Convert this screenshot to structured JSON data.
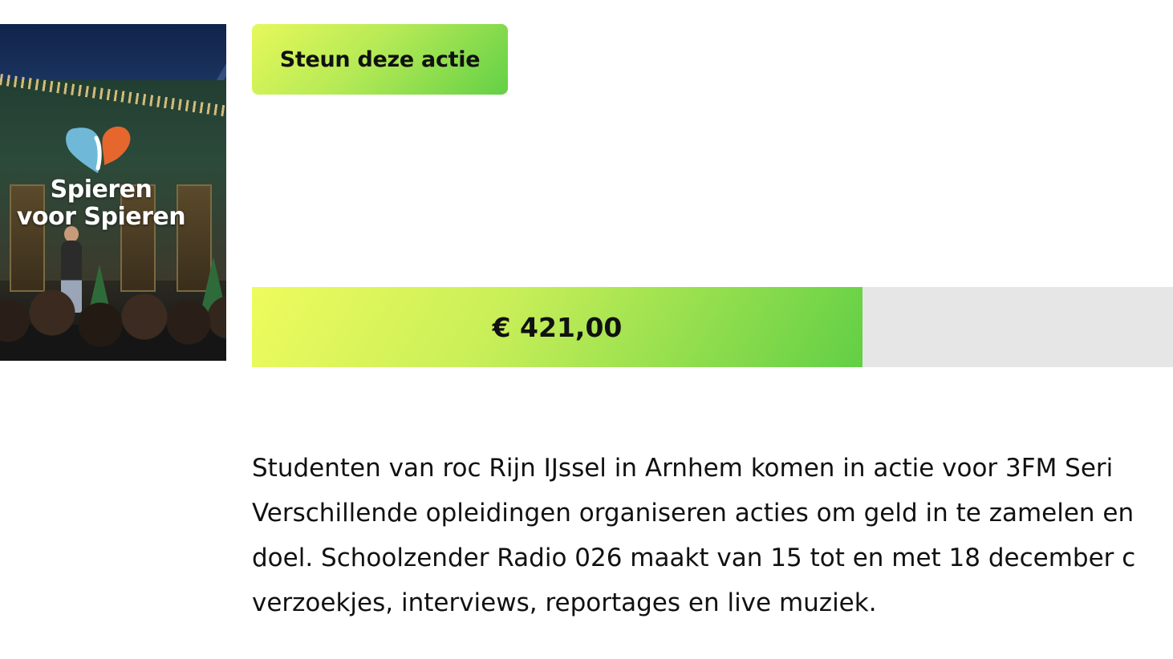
{
  "campaign": {
    "image_logo_text_line1": "Spieren",
    "image_logo_text_line2": "voor Spieren",
    "heart_colors": {
      "left": "#6fb8d8",
      "right": "#e5672d"
    }
  },
  "cta": {
    "label": "Steun deze actie",
    "gradient_start": "#e6f85a",
    "gradient_end": "#63d046"
  },
  "progress": {
    "amount_label": "€ 421,00",
    "fill_fraction": 0.656,
    "track_color": "#e6e6e6"
  },
  "description": {
    "lines": [
      "Studenten van roc Rijn IJssel in Arnhem komen in actie voor 3FM Seri",
      "Verschillende opleidingen organiseren acties om geld in te zamelen en",
      "doel. Schoolzender Radio 026 maakt van 15 tot en met 18 december c",
      "verzoekjes, interviews, reportages en live muziek."
    ]
  }
}
